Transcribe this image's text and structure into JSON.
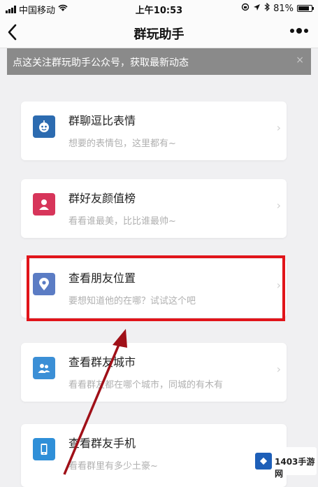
{
  "status_bar": {
    "carrier": "中国移动",
    "time": "上午10:53",
    "battery": "81%",
    "battery_level": 0.81
  },
  "nav": {
    "back_icon": "chevron-left-icon",
    "title": "群玩助手",
    "more_icon": "more-dots-icon"
  },
  "notice": {
    "text": "点这关注群玩助手公众号，获取最新动态",
    "close": "×"
  },
  "cards": [
    {
      "title": "群聊逗比表情",
      "desc": "想要的表情包，这里都有~",
      "icon": "emoji-icon",
      "color": "#2c6bb0"
    },
    {
      "title": "群好友颜值榜",
      "desc": "看看谁最美，比比谁最帅~",
      "icon": "profile-icon",
      "color": "#d7355a"
    },
    {
      "title": "查看朋友位置",
      "desc": "要想知道他的在哪？试试这个吧",
      "icon": "location-icon",
      "color": "#5b7cc4"
    },
    {
      "title": "查看群友城市",
      "desc": "看看群友都在哪个城市，同城的有木有",
      "icon": "group-icon",
      "color": "#3b8fd6"
    },
    {
      "title": "查看群友手机",
      "desc": "看看群里有多少土豪~",
      "icon": "phone-icon",
      "color": "#2f8fd8"
    }
  ],
  "chevron": "›",
  "watermark": {
    "text": "1403手游网"
  },
  "colors": {
    "highlight": "#e1141a",
    "arrow": "#a01018"
  }
}
